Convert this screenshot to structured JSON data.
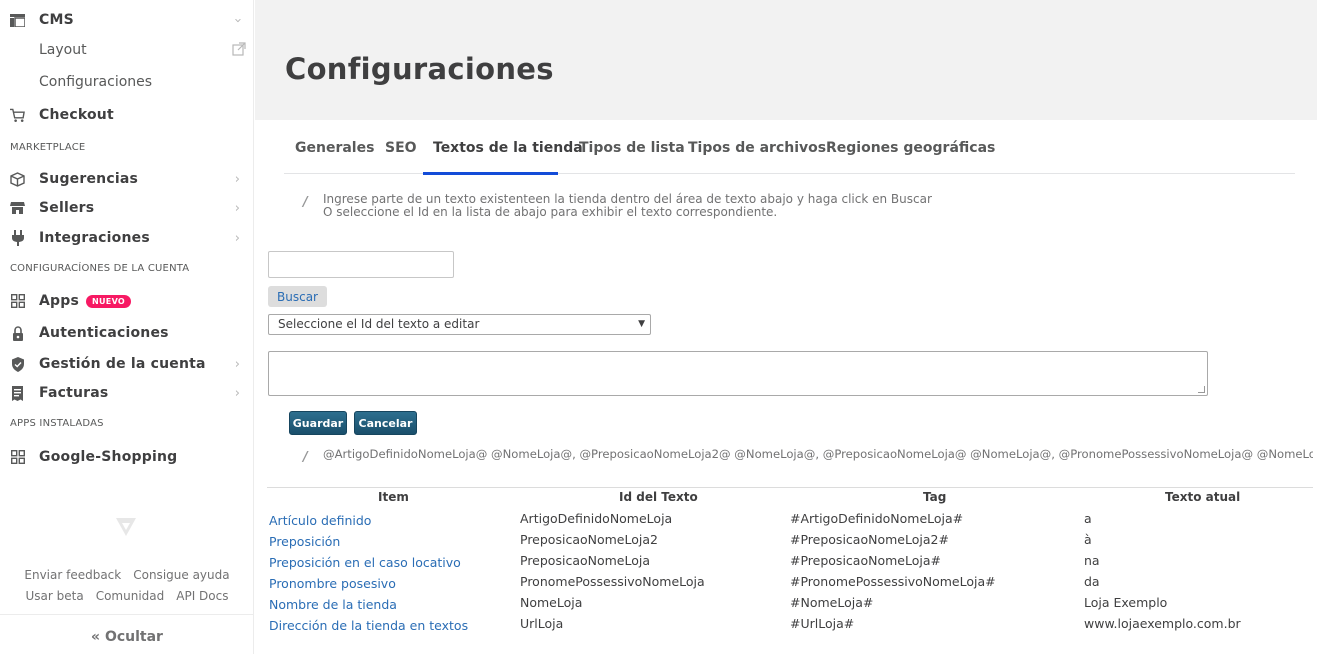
{
  "sidebar": {
    "cms": {
      "label": "CMS",
      "icon": "layout-icon"
    },
    "cms_items": [
      "Layout",
      "Configuraciones"
    ],
    "checkout": {
      "label": "Checkout",
      "icon": "cart-icon"
    },
    "section_marketplace": "MARKETPLACE",
    "marketplace_items": [
      {
        "label": "Sugerencias",
        "icon": "box-icon"
      },
      {
        "label": "Sellers",
        "icon": "store-icon"
      },
      {
        "label": "Integraciones",
        "icon": "plug-icon"
      }
    ],
    "section_account": "CONFIGURACÍONES DE LA CUENTA",
    "account_items": [
      {
        "label": "Apps",
        "icon": "apps-grid-icon",
        "badge": "NUEVO"
      },
      {
        "label": "Autenticaciones",
        "icon": "lock-icon"
      },
      {
        "label": "Gestión de la cuenta",
        "icon": "shield-icon"
      },
      {
        "label": "Facturas",
        "icon": "invoice-icon"
      }
    ],
    "section_installed": "APPS INSTALADAS",
    "installed_items": [
      {
        "label": "Google-Shopping",
        "icon": "apps-grid-icon"
      }
    ],
    "footer_links_row1": [
      "Enviar feedback",
      "Consigue ayuda"
    ],
    "footer_links_row2": [
      "Usar beta",
      "Comunidad",
      "API Docs"
    ],
    "hide_label": "« Ocultar"
  },
  "main": {
    "title": "Configuraciones",
    "tabs": [
      {
        "label": "Generales",
        "active": false
      },
      {
        "label": "SEO",
        "active": false
      },
      {
        "label": "Textos de la tienda",
        "active": true
      },
      {
        "label": "Tipos de lista",
        "active": false
      },
      {
        "label": "Tipos de archivos",
        "active": false
      },
      {
        "label": "Regiones geográficas",
        "active": false
      }
    ],
    "hint_line1": "Ingrese parte de un texto existenteen la tienda dentro del área de texto abajo y haga click en Buscar",
    "hint_line2": "O seleccione el Id en la lista de abajo para exhibir el texto correspondiente.",
    "search_value": "",
    "search_button": "Buscar",
    "select_value": "Seleccione el Id del texto a editar",
    "textarea_value": "",
    "save_button": "Guardar",
    "cancel_button": "Cancelar",
    "variables_hint": "@ArtigoDefinidoNomeLoja@ @NomeLoja@, @PreposicaoNomeLoja2@ @NomeLoja@, @PreposicaoNomeLoja@ @NomeLoja@, @PronomePossessivoNomeLoja@ @NomeLoja@",
    "table": {
      "headers": [
        "Item",
        "Id del Texto",
        "Tag",
        "Texto atual"
      ],
      "rows": [
        [
          "Artículo definido",
          "ArtigoDefinidoNomeLoja",
          "#ArtigoDefinidoNomeLoja#",
          "a"
        ],
        [
          "Preposición",
          "PreposicaoNomeLoja2",
          "#PreposicaoNomeLoja2#",
          "à"
        ],
        [
          "Preposición en el caso locativo",
          "PreposicaoNomeLoja",
          "#PreposicaoNomeLoja#",
          "na"
        ],
        [
          "Pronombre posesivo",
          "PronomePossessivoNomeLoja",
          "#PronomePossessivoNomeLoja#",
          "da"
        ],
        [
          "Nombre de la tienda",
          "NomeLoja",
          "#NomeLoja#",
          "Loja Exemplo"
        ],
        [
          "Dirección de la tienda en textos",
          "UrlLoja",
          "#UrlLoja#",
          "www.lojaexemplo.com.br"
        ]
      ]
    }
  },
  "colors": {
    "accent_blue": "#134cd8",
    "link": "#2a6db5",
    "badge": "#f71963",
    "header_bg": "#f2f2f2"
  }
}
